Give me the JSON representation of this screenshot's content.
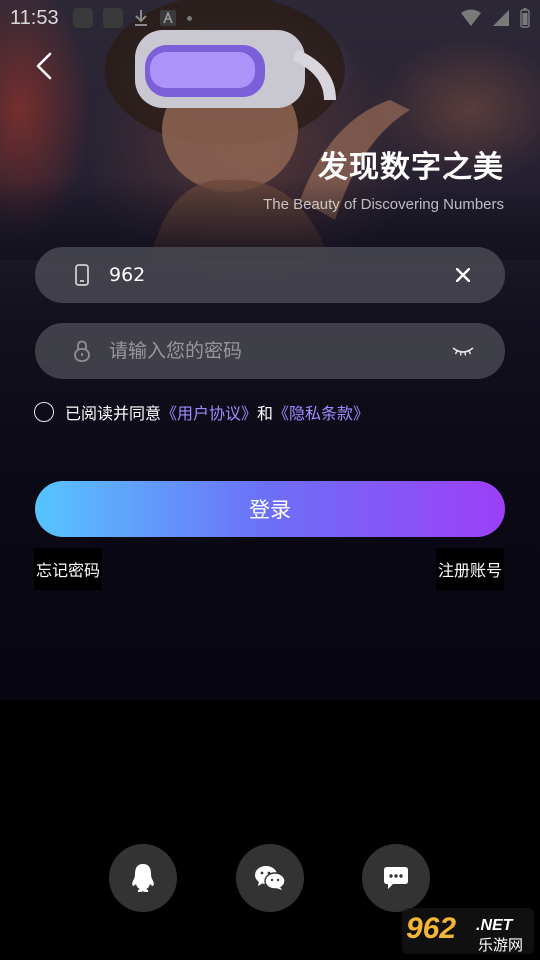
{
  "status_bar": {
    "time": "11:53"
  },
  "hero": {
    "title": "发现数字之美",
    "subtitle": "The Beauty of Discovering Numbers"
  },
  "phone_field": {
    "value": "962"
  },
  "password_field": {
    "placeholder": "请输入您的密码"
  },
  "agreement": {
    "prefix": "已阅读并同意",
    "user_agreement": "《用户协议》",
    "conjunction": "和",
    "privacy_policy": "《隐私条款》"
  },
  "login_button": {
    "label": "登录"
  },
  "links": {
    "forgot_password": "忘记密码",
    "register": "注册账号"
  },
  "social_login": [
    {
      "icon": "qq-icon"
    },
    {
      "icon": "wechat-icon"
    },
    {
      "icon": "sms-icon"
    }
  ],
  "watermark": {
    "brand_number": "962",
    "brand_suffix": ".NET",
    "brand_cn": "乐游网"
  },
  "colors": {
    "button_gradient_start": "#57c5ff",
    "button_gradient_end": "#9d3ff8",
    "link": "#a18aff",
    "field_bg": "#52525a",
    "social_bg": "#333333"
  }
}
